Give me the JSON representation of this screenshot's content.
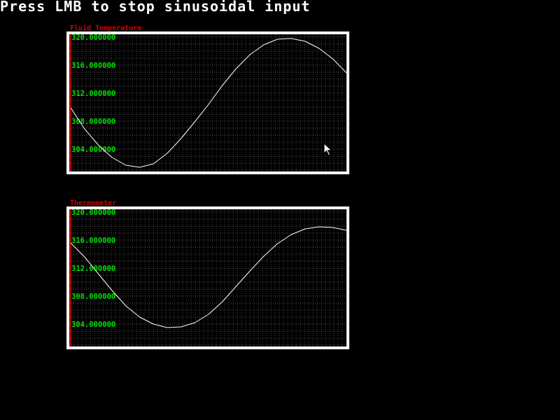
{
  "instruction": "Press LMB to stop sinusoidal input",
  "colors": {
    "background": "#000000",
    "frame": "#ffffff",
    "title": "#d40000",
    "tick_label": "#00e000",
    "grid": "#6a6a6a",
    "axis": "#d40000",
    "trace": "#ffffff"
  },
  "cursor": {
    "icon": "arrow-pointer-icon"
  },
  "chart_data": [
    {
      "type": "line",
      "title": "Fluid Temperature",
      "xlabel": "",
      "ylabel": "",
      "ylim": [
        300,
        320
      ],
      "xlim": [
        0,
        100
      ],
      "y_ticks": [
        {
          "value": 320,
          "label": "320.000000"
        },
        {
          "value": 316,
          "label": "316.000000"
        },
        {
          "value": 312,
          "label": "312.000000"
        },
        {
          "value": 308,
          "label": "308.000000"
        },
        {
          "value": 304,
          "label": "304.000000"
        }
      ],
      "grid": true,
      "series": [
        {
          "x": [
            0,
            5,
            10,
            15,
            20,
            25,
            30,
            35,
            40,
            45,
            50,
            55,
            60,
            65,
            70,
            75,
            80,
            85,
            90,
            95,
            100
          ],
          "y": [
            309.9,
            306.9,
            304.6,
            302.8,
            301.7,
            301.4,
            301.9,
            303.4,
            305.5,
            307.9,
            310.4,
            313.1,
            315.5,
            317.5,
            318.9,
            319.7,
            319.8,
            319.4,
            318.4,
            316.9,
            314.9
          ]
        }
      ]
    },
    {
      "type": "line",
      "title": "Thermometer",
      "xlabel": "",
      "ylabel": "",
      "ylim": [
        300,
        320
      ],
      "xlim": [
        0,
        100
      ],
      "y_ticks": [
        {
          "value": 320,
          "label": "320.000000"
        },
        {
          "value": 316,
          "label": "316.000000"
        },
        {
          "value": 312,
          "label": "312.000000"
        },
        {
          "value": 308,
          "label": "308.000000"
        },
        {
          "value": 304,
          "label": "304.000000"
        }
      ],
      "grid": true,
      "series": [
        {
          "x": [
            0,
            5,
            10,
            15,
            20,
            25,
            30,
            35,
            40,
            45,
            50,
            55,
            60,
            65,
            70,
            75,
            80,
            85,
            90,
            95,
            100
          ],
          "y": [
            315.6,
            313.6,
            311.2,
            308.8,
            306.6,
            305.0,
            304.0,
            303.5,
            303.6,
            304.2,
            305.4,
            307.2,
            309.4,
            311.6,
            313.7,
            315.5,
            316.8,
            317.6,
            317.9,
            317.8,
            317.4
          ]
        }
      ]
    }
  ]
}
